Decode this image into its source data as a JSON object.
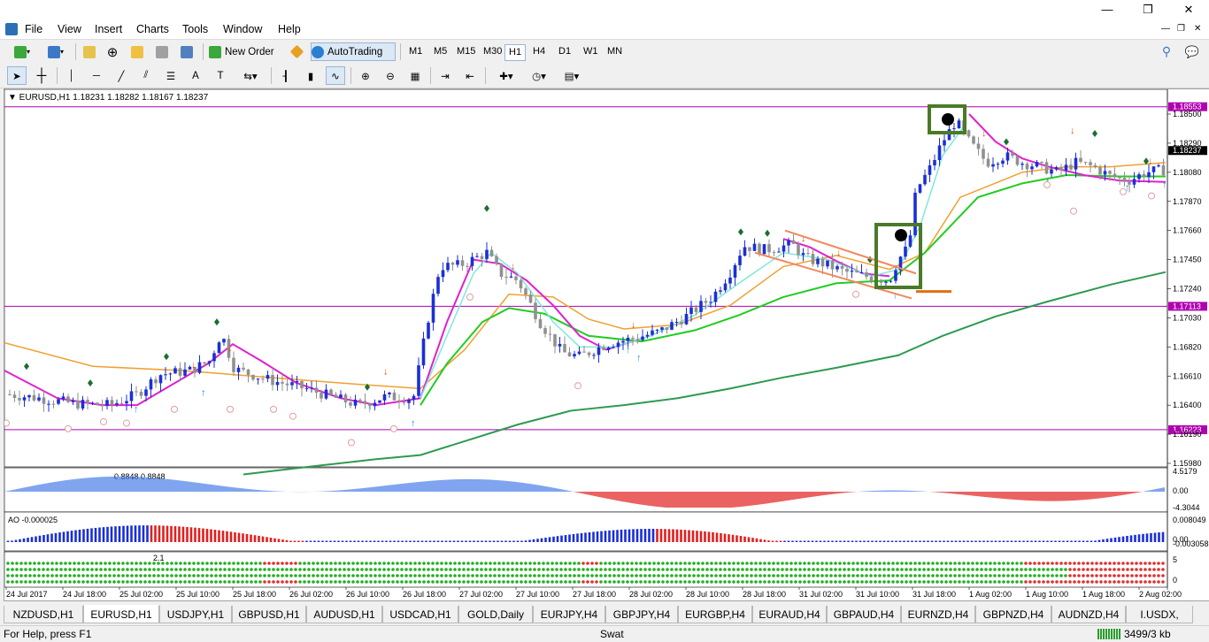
{
  "window": {
    "minimize": "—",
    "maximize": "❐",
    "close": "✕"
  },
  "menu": [
    "File",
    "View",
    "Insert",
    "Charts",
    "Tools",
    "Window",
    "Help"
  ],
  "mdi_buttons": [
    "—",
    "❐",
    "✕"
  ],
  "toolbar": {
    "new_order": "New Order",
    "auto_trading": "AutoTrading",
    "timeframes": [
      "M1",
      "M5",
      "M15",
      "M30",
      "H1",
      "H4",
      "D1",
      "W1",
      "MN"
    ],
    "active_timeframe": "H1"
  },
  "chart": {
    "header": "EURUSD,H1  1.18231 1.18282 1.18167 1.18237",
    "price_labels": [
      "1.18500",
      "1.18290",
      "1.18080",
      "1.17870",
      "1.17660",
      "1.17450",
      "1.17240",
      "1.17030",
      "1.16820",
      "1.16610",
      "1.16400",
      "1.16190",
      "1.15980"
    ],
    "hlines": [
      {
        "price": "1.18553",
        "color": "#b000b0"
      },
      {
        "price": "1.17113",
        "color": "#b000b0"
      },
      {
        "price": "1.16223",
        "color": "#b000b0"
      }
    ],
    "current_price": "1.18237",
    "time_labels": [
      "24 Jul 2017",
      "24 Jul 18:00",
      "25 Jul 02:00",
      "25 Jul 10:00",
      "25 Jul 18:00",
      "26 Jul 02:00",
      "26 Jul 10:00",
      "26 Jul 18:00",
      "27 Jul 02:00",
      "27 Jul 10:00",
      "27 Jul 18:00",
      "28 Jul 02:00",
      "28 Jul 10:00",
      "28 Jul 18:00",
      "31 Jul 02:00",
      "31 Jul 10:00",
      "31 Jul 18:00",
      "1 Aug 02:00",
      "1 Aug 10:00",
      "1 Aug 18:00",
      "2 Aug 02:00"
    ],
    "osc1": {
      "label": "0.8848 0.8848",
      "scale": [
        "4.5179",
        "0.00",
        "-4.3044"
      ]
    },
    "osc2": {
      "label": "AO -0.000025",
      "scale": [
        "0.008049",
        "0.00",
        "-0.003058"
      ]
    },
    "osc3": {
      "marker": "2.1",
      "scale": [
        "5",
        "0"
      ]
    },
    "colors": {
      "bull": "#1a2fd6",
      "bear": "#909090",
      "ma_orange": "#f0a030",
      "ma_green": "#22cc22",
      "ma_dark": "#2e9a50",
      "ma_magenta": "#e020d0",
      "ma_cyan": "#7fe8d8",
      "frame": "#4a7a28"
    }
  },
  "tabs": [
    "NZDUSD,H1",
    "EURUSD,H1",
    "USDJPY,H1",
    "GBPUSD,H1",
    "AUDUSD,H1",
    "USDCAD,H1",
    "GOLD,Daily",
    "EURJPY,H4",
    "GBPJPY,H4",
    "EURGBP,H4",
    "EURAUD,H4",
    "GBPAUD,H4",
    "EURNZD,H4",
    "GBPNZD,H4",
    "AUDNZD,H4",
    "I.USDX,"
  ],
  "active_tab": "EURUSD,H1",
  "status": {
    "help": "For Help, press F1",
    "profile": "Swat",
    "traffic": "3499/3 kb"
  }
}
